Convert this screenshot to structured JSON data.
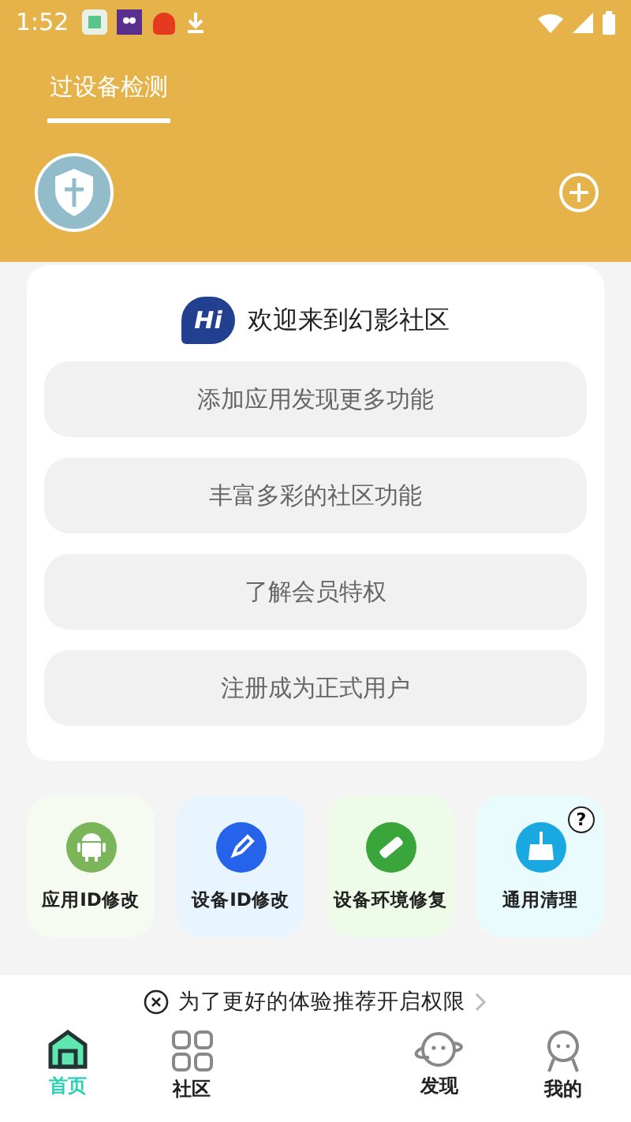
{
  "status_bar": {
    "time": "1:52"
  },
  "tabs": [
    {
      "label": "过设备检测",
      "selected": true
    }
  ],
  "welcome": {
    "logo": "Hi",
    "title": "欢迎来到幻影社区"
  },
  "actions": [
    "添加应用发现更多功能",
    "丰富多彩的社区功能",
    "了解会员特权",
    "注册成为正式用户"
  ],
  "tools": [
    {
      "kind": "android",
      "label": "应用ID修改"
    },
    {
      "kind": "pen",
      "label": "设备ID修改"
    },
    {
      "kind": "patch",
      "label": "设备环境修复"
    },
    {
      "kind": "broom",
      "label": "通用清理",
      "help": "?"
    }
  ],
  "notice": {
    "text": "为了更好的体验推荐开启权限"
  },
  "nav": [
    {
      "kind": "home",
      "label": "首页",
      "selected": true
    },
    {
      "kind": "grid",
      "label": "社区",
      "selected": false
    },
    {
      "kind": "planet",
      "label": "发现",
      "selected": false
    },
    {
      "kind": "face",
      "label": "我的",
      "selected": false
    }
  ]
}
